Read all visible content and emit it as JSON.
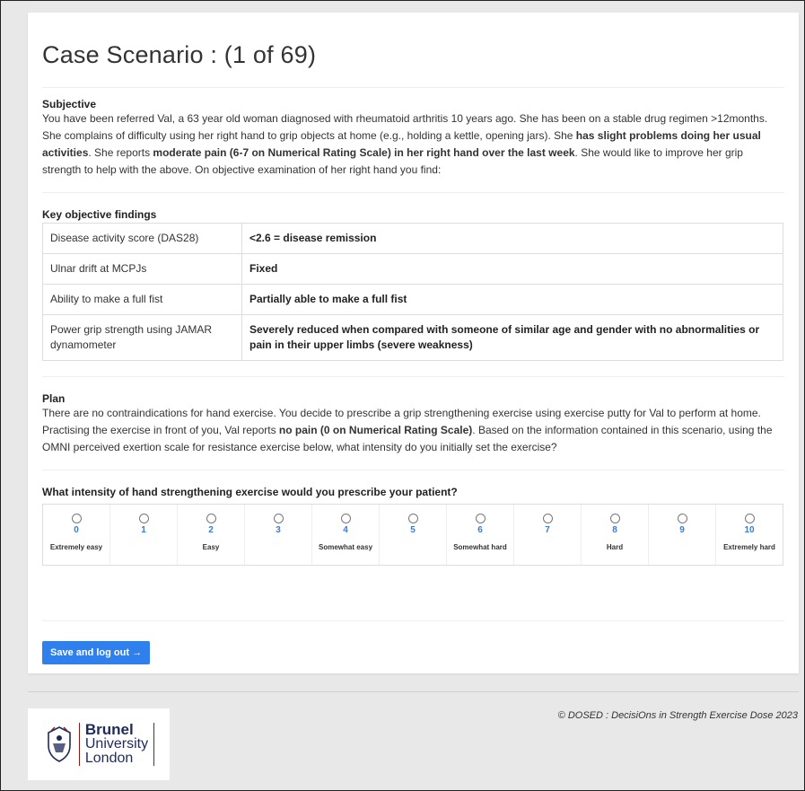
{
  "page_title": "Case Scenario : (1 of 69)",
  "subjective": {
    "heading": "Subjective",
    "parts": [
      {
        "text": "You have been referred Val, a 63 year old woman diagnosed with rheumatoid arthritis 10 years ago. She has been on a stable drug regimen >12months. She complains of difficulty using her right hand to grip objects at home (e.g., holding a kettle, opening jars). She ",
        "bold": false
      },
      {
        "text": "has slight problems doing her usual activities",
        "bold": true
      },
      {
        "text": ". She reports ",
        "bold": false
      },
      {
        "text": "moderate pain (6-7 on Numerical Rating Scale) in her right hand over the last week",
        "bold": true
      },
      {
        "text": ". She would like to improve her grip strength to help with the above. On objective examination of her right hand you find:",
        "bold": false
      }
    ]
  },
  "findings": {
    "heading": "Key objective findings",
    "rows": [
      {
        "label": "Disease activity score (DAS28)",
        "value": "<2.6 = disease remission"
      },
      {
        "label": "Ulnar drift at MCPJs",
        "value": "Fixed"
      },
      {
        "label": "Ability to make a full fist",
        "value": "Partially able to make a full fist"
      },
      {
        "label": "Power grip strength using JAMAR dynamometer",
        "value": "Severely reduced when compared with someone of similar age and gender with no abnormalities or pain in their upper limbs (severe weakness)"
      }
    ]
  },
  "plan": {
    "heading": "Plan",
    "parts": [
      {
        "text": "There are no contraindications for hand exercise. You decide to prescribe a grip strengthening exercise using exercise putty for Val to perform at home. Practising the exercise in front of you, Val reports ",
        "bold": false
      },
      {
        "text": "no pain (0 on Numerical Rating Scale)",
        "bold": true
      },
      {
        "text": ". Based on the information contained in this scenario, using the OMNI perceived exertion scale for resistance exercise below, what intensity do you initially set the exercise?",
        "bold": false
      }
    ]
  },
  "question": "What intensity of hand strengthening exercise would you prescribe your patient?",
  "scale_options": [
    {
      "value": "0",
      "label": "Extremely easy"
    },
    {
      "value": "1",
      "label": ""
    },
    {
      "value": "2",
      "label": "Easy"
    },
    {
      "value": "3",
      "label": ""
    },
    {
      "value": "4",
      "label": "Somewhat easy"
    },
    {
      "value": "5",
      "label": ""
    },
    {
      "value": "6",
      "label": "Somewhat hard"
    },
    {
      "value": "7",
      "label": ""
    },
    {
      "value": "8",
      "label": "Hard"
    },
    {
      "value": "9",
      "label": ""
    },
    {
      "value": "10",
      "label": "Extremely hard"
    }
  ],
  "save_button": "Save and log out →",
  "footer": {
    "copyright": "© DOSED : DecisiOns in Strength Exercise Dose 2023",
    "logo_line1": "Brunel",
    "logo_line2": "University",
    "logo_line3": "London"
  },
  "colors": {
    "accent": "#2f80ed",
    "scale_number": "#3a7bd5",
    "logo_navy": "#1f2a5a",
    "logo_red": "#8b1a1a"
  }
}
